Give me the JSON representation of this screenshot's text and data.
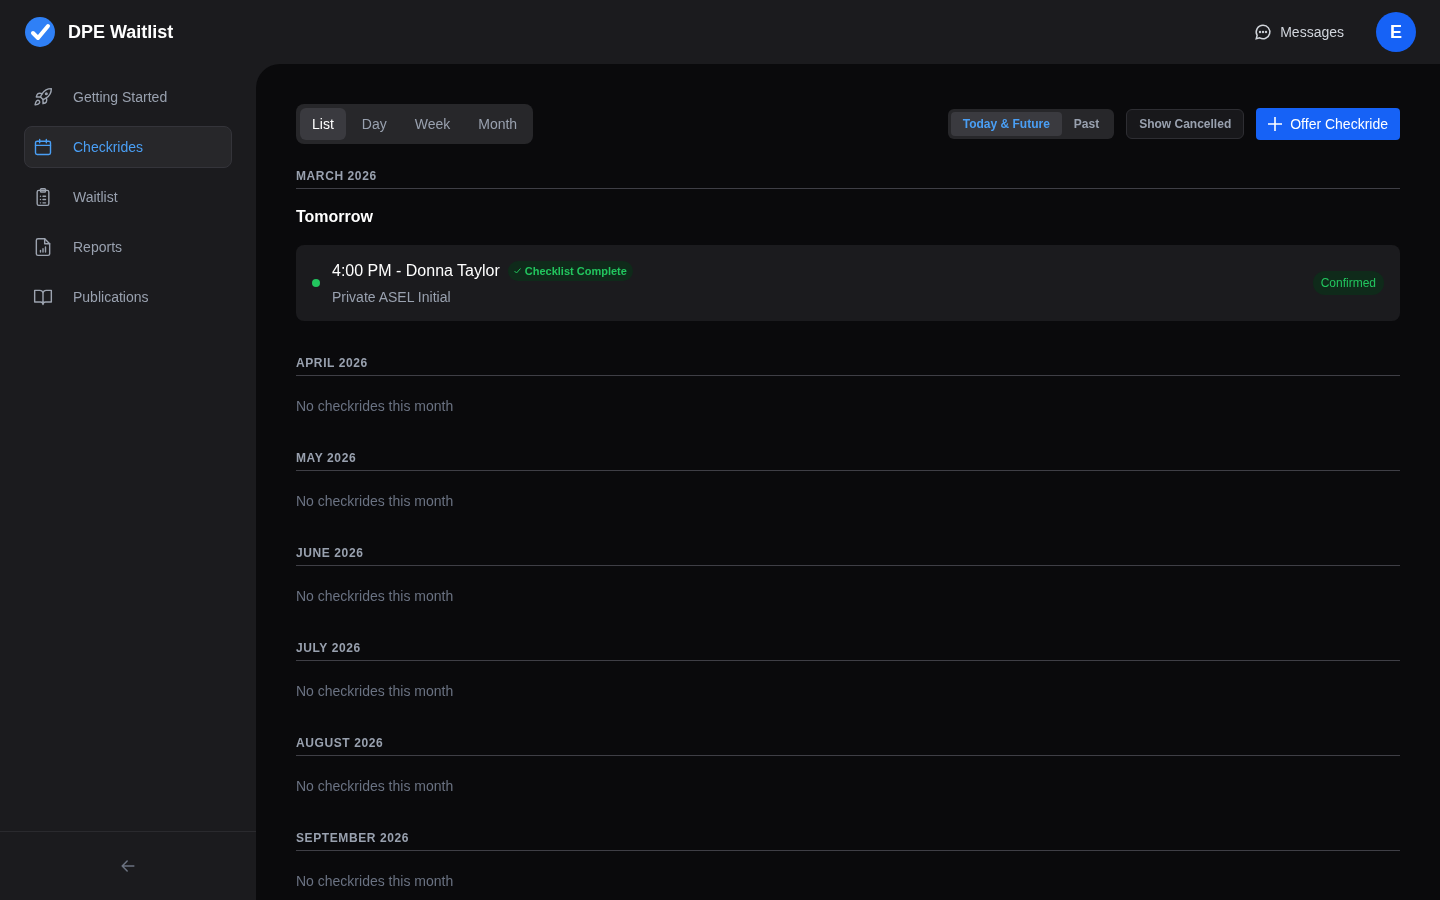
{
  "app": {
    "title": "DPE Waitlist"
  },
  "header": {
    "messages_label": "Messages",
    "avatar_initial": "E"
  },
  "sidebar": {
    "items": [
      {
        "label": "Getting Started",
        "kind": "rocket",
        "selected": false
      },
      {
        "label": "Checkrides",
        "kind": "calendar",
        "selected": true
      },
      {
        "label": "Waitlist",
        "kind": "clipboard",
        "selected": false
      },
      {
        "label": "Reports",
        "kind": "report",
        "selected": false
      },
      {
        "label": "Publications",
        "kind": "book",
        "selected": false
      }
    ]
  },
  "view_tabs": [
    {
      "label": "List",
      "selected": true
    },
    {
      "label": "Day",
      "selected": false
    },
    {
      "label": "Week",
      "selected": false
    },
    {
      "label": "Month",
      "selected": false
    }
  ],
  "time_filter": [
    {
      "label": "Today & Future",
      "selected": true
    },
    {
      "label": "Past",
      "selected": false
    }
  ],
  "show_cancelled": {
    "label": "Show Cancelled"
  },
  "offer_button": {
    "label": "Offer Checkride"
  },
  "months": [
    {
      "heading": "MARCH 2026",
      "days": [
        {
          "label": "Tomorrow",
          "checkrides": [
            {
              "title": "4:00 PM - Donna Taylor",
              "badge": "Checklist Complete",
              "subtitle": "Private ASEL Initial",
              "status": "Confirmed",
              "color": "#22c55e"
            }
          ]
        }
      ]
    },
    {
      "heading": "APRIL 2026",
      "empty_text": "No checkrides this month"
    },
    {
      "heading": "MAY 2026",
      "empty_text": "No checkrides this month"
    },
    {
      "heading": "JUNE 2026",
      "empty_text": "No checkrides this month"
    },
    {
      "heading": "JULY 2026",
      "empty_text": "No checkrides this month"
    },
    {
      "heading": "AUGUST 2026",
      "empty_text": "No checkrides this month"
    },
    {
      "heading": "SEPTEMBER 2026",
      "empty_text": "No checkrides this month"
    }
  ]
}
